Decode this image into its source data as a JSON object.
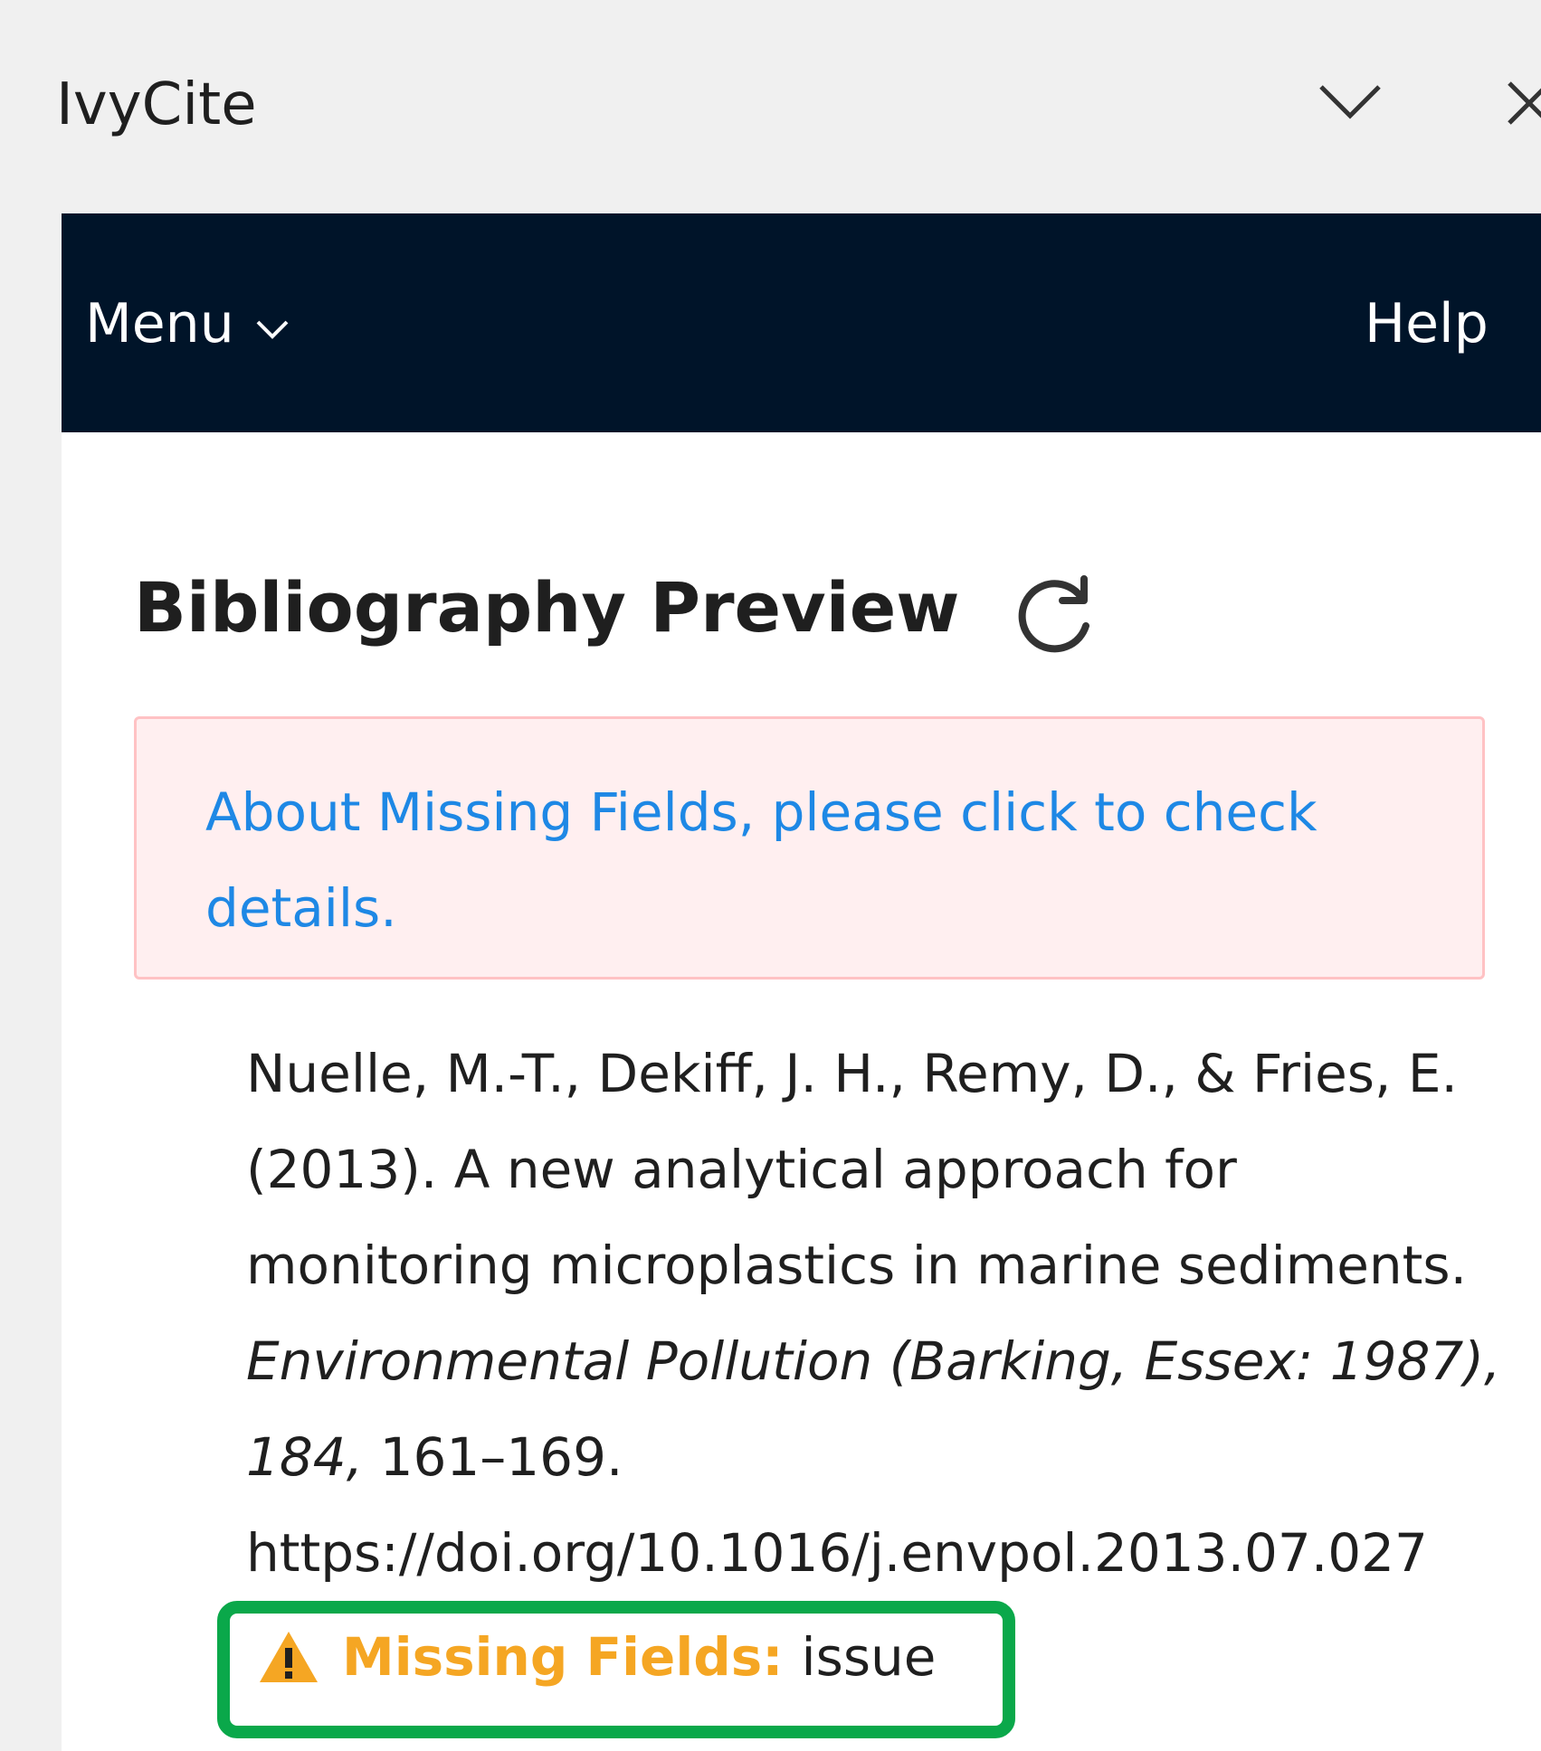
{
  "pane": {
    "title": "IvyCite"
  },
  "navbar": {
    "menu_label": "Menu",
    "help_label": "Help"
  },
  "main": {
    "section_title": "Bibliography Preview",
    "alert_text": "About Missing Fields, please click to check details.",
    "citation": {
      "authors": "Nuelle, M.-T., Dekiff, J. H., Remy, D., & Fries, E. (2013). A new analytical approach for monitoring microplastics in marine sediments.",
      "journal": "Environmental Pollution (Barking, Essex: 1987), 184,",
      "pages": "161–169.",
      "doi": "https://doi.org/10.1016/j.envpol.2013.07.027"
    },
    "missing_fields": {
      "label": "Missing Fields:",
      "value": "issue"
    }
  },
  "colors": {
    "navbar_bg": "#001429",
    "alert_bg": "#ffeff0",
    "alert_border": "#ffc2c4",
    "link": "#1e88e5",
    "warning": "#f5a623",
    "highlight": "#0aa84a"
  },
  "icons": {
    "collapse": "chevron-down-icon",
    "close": "close-icon",
    "menu_chevron": "chevron-down-icon",
    "refresh": "refresh-icon",
    "warning": "warning-icon"
  }
}
